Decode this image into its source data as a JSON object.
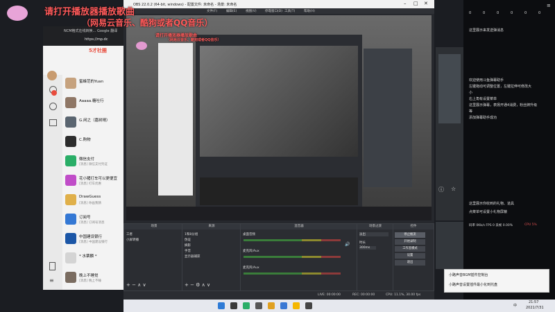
{
  "overlay": {
    "line1": "请打开播放器播放歌曲",
    "line2": "（网易云音乐、酷狗或者QQ音乐）",
    "mini_line1": "请打开播放器播放歌曲",
    "mini_line2": "（网易云音乐、酷狗或者QQ音乐）"
  },
  "browser": {
    "tab_label": "NCM格式在线转换...",
    "tab2_label": "Google 翻译",
    "address": "https://mp.dc",
    "logo_text": "5才社圈"
  },
  "chat": {
    "contacts": [
      {
        "name": "蜜蜂范的Yuan",
        "sub": "",
        "color": "#c6a27e"
      },
      {
        "name": "Aaaaa.糖吐行",
        "sub": "",
        "color": "#8f7766"
      },
      {
        "name": "G.闲之（嘉树晴）",
        "sub": "",
        "color": "#5a6570"
      },
      {
        "name": "C.购物",
        "sub": "",
        "color": "#2d2d2d"
      },
      {
        "name": "微信支付",
        "sub": "[消息] 微信支付凭证",
        "color": "#2aae67"
      },
      {
        "name": "花小猪打车可以更便宜",
        "sub": "[消息] 打车优惠",
        "color": "#c04dc8"
      },
      {
        "name": "DrawGuess",
        "sub": "[消息] 你画我猜",
        "color": "#e0b04a"
      },
      {
        "name": "订阅号",
        "sub": "[消息] 订阅号消息",
        "color": "#3478d4"
      },
      {
        "name": "中国建设银行",
        "sub": "[消息] 中国建设银行",
        "color": "#1b56a6"
      },
      {
        "name": "* 水票麟 *",
        "sub": "",
        "color": "#d4d4d4"
      },
      {
        "name": "晚上不睡觉",
        "sub": "[消息] 晚上不睡",
        "color": "#7a6c60"
      }
    ]
  },
  "obs": {
    "title": "OBS 22.0.2 (64-bit, windows) - 配置文件: 未命名 - 场景: 未命名",
    "menu": [
      "文件(F)",
      "编辑(E)",
      "视图(V)",
      "停靠窗口(D)",
      "工具(T)",
      "帮助(H)"
    ],
    "docks": {
      "scenes": {
        "title": "场景",
        "items": [
          "工者",
          "小屏转播"
        ]
      },
      "sources": {
        "title": "来源",
        "items": [
          "1和8分组",
          "伪证",
          "摘影",
          "手音",
          "显示器捕获"
        ]
      },
      "mixer": {
        "title": "混音器",
        "channels": [
          "桌面音频",
          "麦克风/Aux",
          "麦克风/Aux"
        ]
      },
      "transitions": {
        "title": "场景过渡",
        "mode": "淡出",
        "duration_label": "时长",
        "duration": "300ms"
      },
      "controls": {
        "title": "控件",
        "buttons": [
          "停止推流",
          "开始录制",
          "工作室模式",
          "设置",
          "退出"
        ]
      }
    },
    "status": {
      "live": "LIVE: 00:00:00",
      "rec": "REC: 00:00:00",
      "cpu": "CPU: 11.1%, 30.00 fps"
    }
  },
  "right_panel": {
    "top_stats": [
      "0",
      "0",
      "0",
      "0",
      "0",
      "0"
    ],
    "msg1": "这里展示来发送弹消息",
    "lines": [
      "欢迎使用斗鱼弹幕助手",
      "左键拖动可调整位置，左键拉伸可修改大",
      "小",
      "右上角有设置菜单",
      "这里展示弹幕，表扬开通4消费，粉丝牌升级",
      "等",
      "添加弹幕助手成功"
    ],
    "lines2": [
      "这里展示你收到的礼物、道具",
      "点菜单可设置小礼物屏蔽"
    ],
    "bitrate": "码率 0Kb/s  FPS 0  丢帧 0.00%",
    "cpu": "CPU 5%"
  },
  "notification": {
    "title": "小路声音BGM插件控制台",
    "body": "小路声音设置插件最小化到托盘"
  },
  "taskbar": {
    "time": "21:57",
    "date": "2021/7/31",
    "lang": "中"
  },
  "colors": {
    "accent_red": "#ff5a5a",
    "obs_bg": "#26282d",
    "taskbar": "#e6e8ee"
  }
}
